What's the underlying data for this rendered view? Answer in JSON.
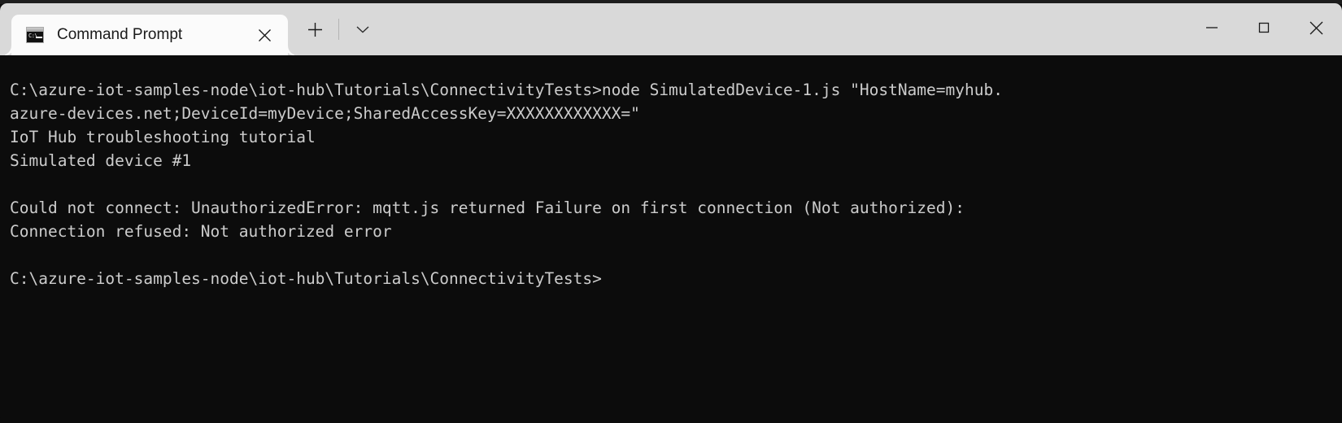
{
  "window": {
    "title": "Command Prompt",
    "background_color": "#0c0c0c",
    "titlebar_color": "#d9d9d9"
  },
  "tabbar": {
    "tabs": [
      {
        "label": "Command Prompt",
        "icon": "console-icon",
        "icon_text": "C:\\",
        "close_label": "✕",
        "active": true
      }
    ],
    "new_tab_label": "+",
    "dropdown_label": "⌄"
  },
  "window_controls": {
    "minimize_label": "—",
    "maximize_label": "□",
    "close_label": "✕"
  },
  "terminal": {
    "foreground_color": "#cccccc",
    "background_color": "#0c0c0c",
    "font_size_px": 19.5,
    "lines": [
      "C:\\azure-iot-samples-node\\iot-hub\\Tutorials\\ConnectivityTests>node SimulatedDevice-1.js \"HostName=myhub.",
      "azure-devices.net;DeviceId=myDevice;SharedAccessKey=XXXXXXXXXXXX=\"",
      "IoT Hub troubleshooting tutorial",
      "Simulated device #1",
      "",
      "Could not connect: UnauthorizedError: mqtt.js returned Failure on first connection (Not authorized):",
      "Connection refused: Not authorized error",
      "",
      "C:\\azure-iot-samples-node\\iot-hub\\Tutorials\\ConnectivityTests>"
    ]
  }
}
